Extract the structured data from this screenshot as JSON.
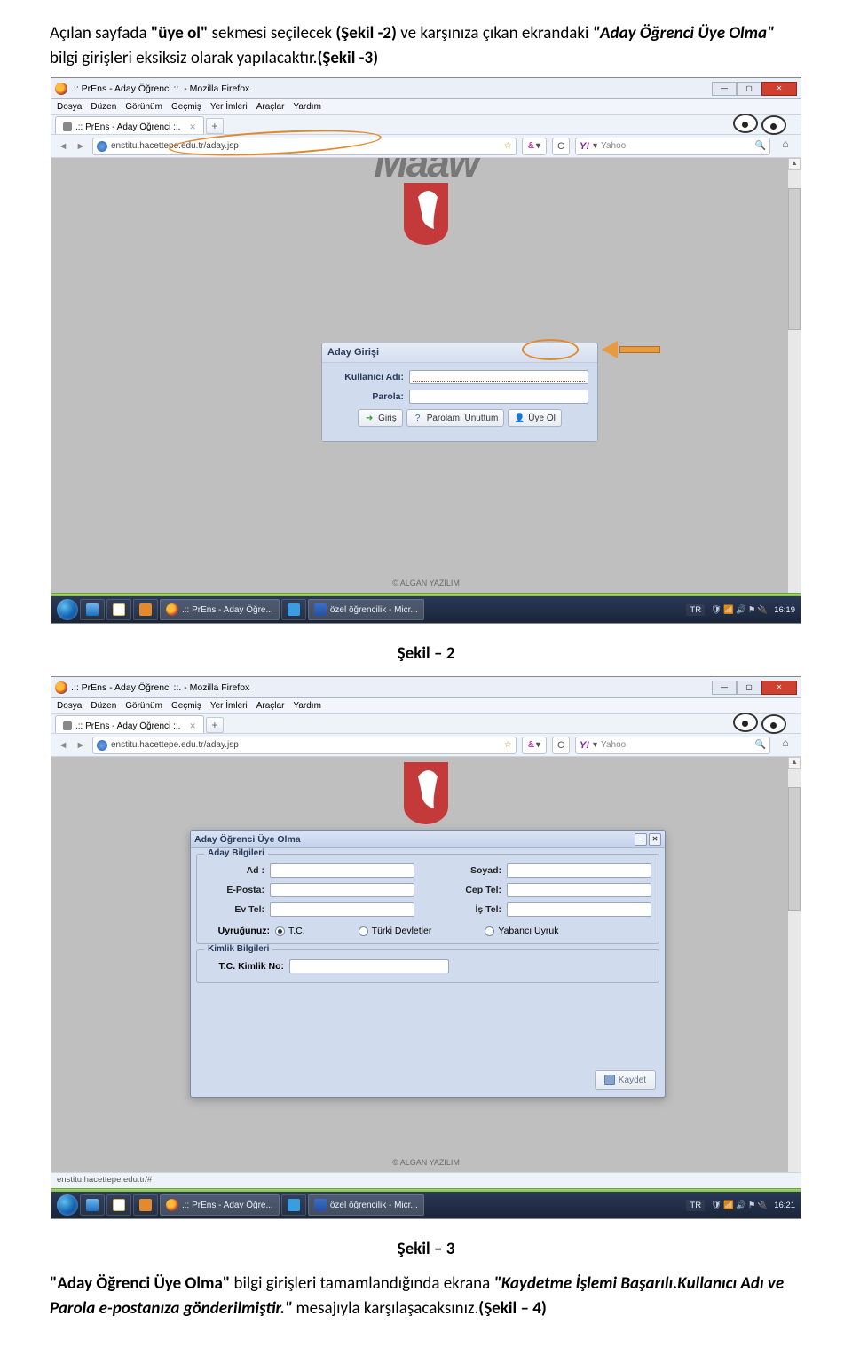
{
  "para1_pre": "Açılan sayfada ",
  "para1_quote1": "\"üye ol\"",
  "para1_mid": " sekmesi seçilecek ",
  "para1_ref1": "(Şekil -2)",
  "para1_mid2": " ve karşınıza çıkan ekrandaki ",
  "para1_quote2": "\"Aday Öğrenci Üye Olma\"",
  "para1_post": " bilgi girişleri eksiksiz olarak yapılacaktır.",
  "para1_ref2": "(Şekil -3)",
  "caption2": "Şekil – 2",
  "caption3": "Şekil – 3",
  "para2_quote1": "\"Aday Öğrenci Üye Olma\"",
  "para2_mid": " bilgi girişleri tamamlandığında ekrana ",
  "para2_quote2": "\"Kaydetme İşlemi Başarılı.Kullanıcı Adı ve Parola e-postanıza gönderilmiştir.\"",
  "para2_post": " mesajıyla karşılaşacaksınız.",
  "para2_ref": "(Şekil – 4)",
  "s1": {
    "win_title": ".:: PrEns - Aday Öğrenci ::. - Mozilla Firefox",
    "menu": [
      "Dosya",
      "Düzen",
      "Görünüm",
      "Geçmiş",
      "Yer İmleri",
      "Araçlar",
      "Yardım"
    ],
    "tab_title": ".:: PrEns - Aday Öğrenci ::.",
    "url": "enstitu.hacettepe.edu.tr/aday.jsp",
    "and": "&",
    "search_prov": "Y!",
    "search_ph": "Yahoo",
    "blur": "Maaw",
    "login_hdr": "Aday Girişi",
    "label_user": "Kullanıcı Adı:",
    "label_pass": "Parola:",
    "btn_login": "Giriş",
    "btn_forgot": "Parolamı Unuttum",
    "btn_signup": "Üye Ol",
    "algan": "© ALGAN YAZILIM",
    "tb_ff": ".:: PrEns - Aday Öğre...",
    "tb_word": "özel öğrencilik - Micr...",
    "lang": "TR",
    "time": "16:19"
  },
  "s2": {
    "win_title": ".:: PrEns - Aday Öğrenci ::. - Mozilla Firefox",
    "menu": [
      "Dosya",
      "Düzen",
      "Görünüm",
      "Geçmiş",
      "Yer İmleri",
      "Araçlar",
      "Yardım"
    ],
    "tab_title": ".:: PrEns - Aday Öğrenci ::.",
    "url": "enstitu.hacettepe.edu.tr/aday.jsp",
    "and": "&",
    "search_prov": "Y!",
    "search_ph": "Yahoo",
    "blur": "",
    "modal_title": "Aday Öğrenci Üye Olma",
    "fs1_legend": "Aday Bilgileri",
    "lbl_ad": "Ad :",
    "lbl_soyad": "Soyad:",
    "lbl_eposta": "E-Posta:",
    "lbl_cep": "Cep Tel:",
    "lbl_ev": "Ev Tel:",
    "lbl_is": "İş Tel:",
    "lbl_uyruk": "Uyruğunuz:",
    "r_tc": "T.C.",
    "r_td": "Türki Devletler",
    "r_yu": "Yabancı Uyruk",
    "fs2_legend": "Kimlik Bilgileri",
    "lbl_tcno": "T.C. Kimlik No:",
    "btn_kaydet": "Kaydet",
    "algan": "© ALGAN YAZILIM",
    "status": "enstitu.hacettepe.edu.tr/#",
    "tb_ff": ".:: PrEns - Aday Öğre...",
    "tb_word": "özel öğrencilik - Micr...",
    "lang": "TR",
    "time": "16:21"
  }
}
